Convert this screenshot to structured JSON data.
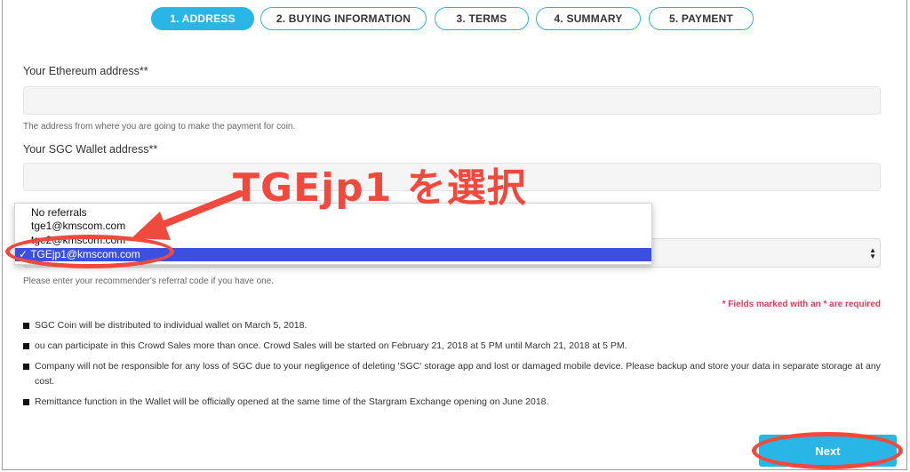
{
  "steps": [
    {
      "label": "1. ADDRESS"
    },
    {
      "label": "2. BUYING INFORMATION"
    },
    {
      "label": "3. TERMS"
    },
    {
      "label": "4. SUMMARY"
    },
    {
      "label": "5. PAYMENT"
    }
  ],
  "form": {
    "eth_label": "Your Ethereum address**",
    "eth_value": "",
    "eth_help": "The address from where you are going to make the payment for coin.",
    "sgc_label": "Your SGC Wallet address**",
    "sgc_value": "",
    "referral_help": "Please enter your recommender's referral code if you have one."
  },
  "dropdown": {
    "options": [
      "No referrals",
      "tge1@kmscom.com",
      "tge2@kmscom.com",
      "TGEjp1@kmscom.com"
    ],
    "selected_check": "✓",
    "selected": "TGEjp1@kmscom.com"
  },
  "required_note": "* Fields marked with an * are required",
  "notes": [
    "SGC Coin will be distributed to individual wallet on March 5, 2018.",
    "ou can participate in this Crowd Sales more than once. Crowd Sales will be started on February 21, 2018 at 5 PM until March 21, 2018 at 5 PM.",
    "Company will not be responsible for any loss of SGC due to your negligence of deleting 'SGC' storage app and lost or damaged mobile device. Please backup and store your data in separate storage at any cost.",
    "Remittance function in the Wallet will be officially opened at the same time of the Stargram Exchange opening on June 2018."
  ],
  "next_label": "Next",
  "annotation": {
    "text": "TGEjp1 を選択",
    "color": "#f04a3e"
  },
  "colors": {
    "accent": "#29b6e6",
    "selection": "#3b4fe0",
    "required": "#e63a5a"
  }
}
